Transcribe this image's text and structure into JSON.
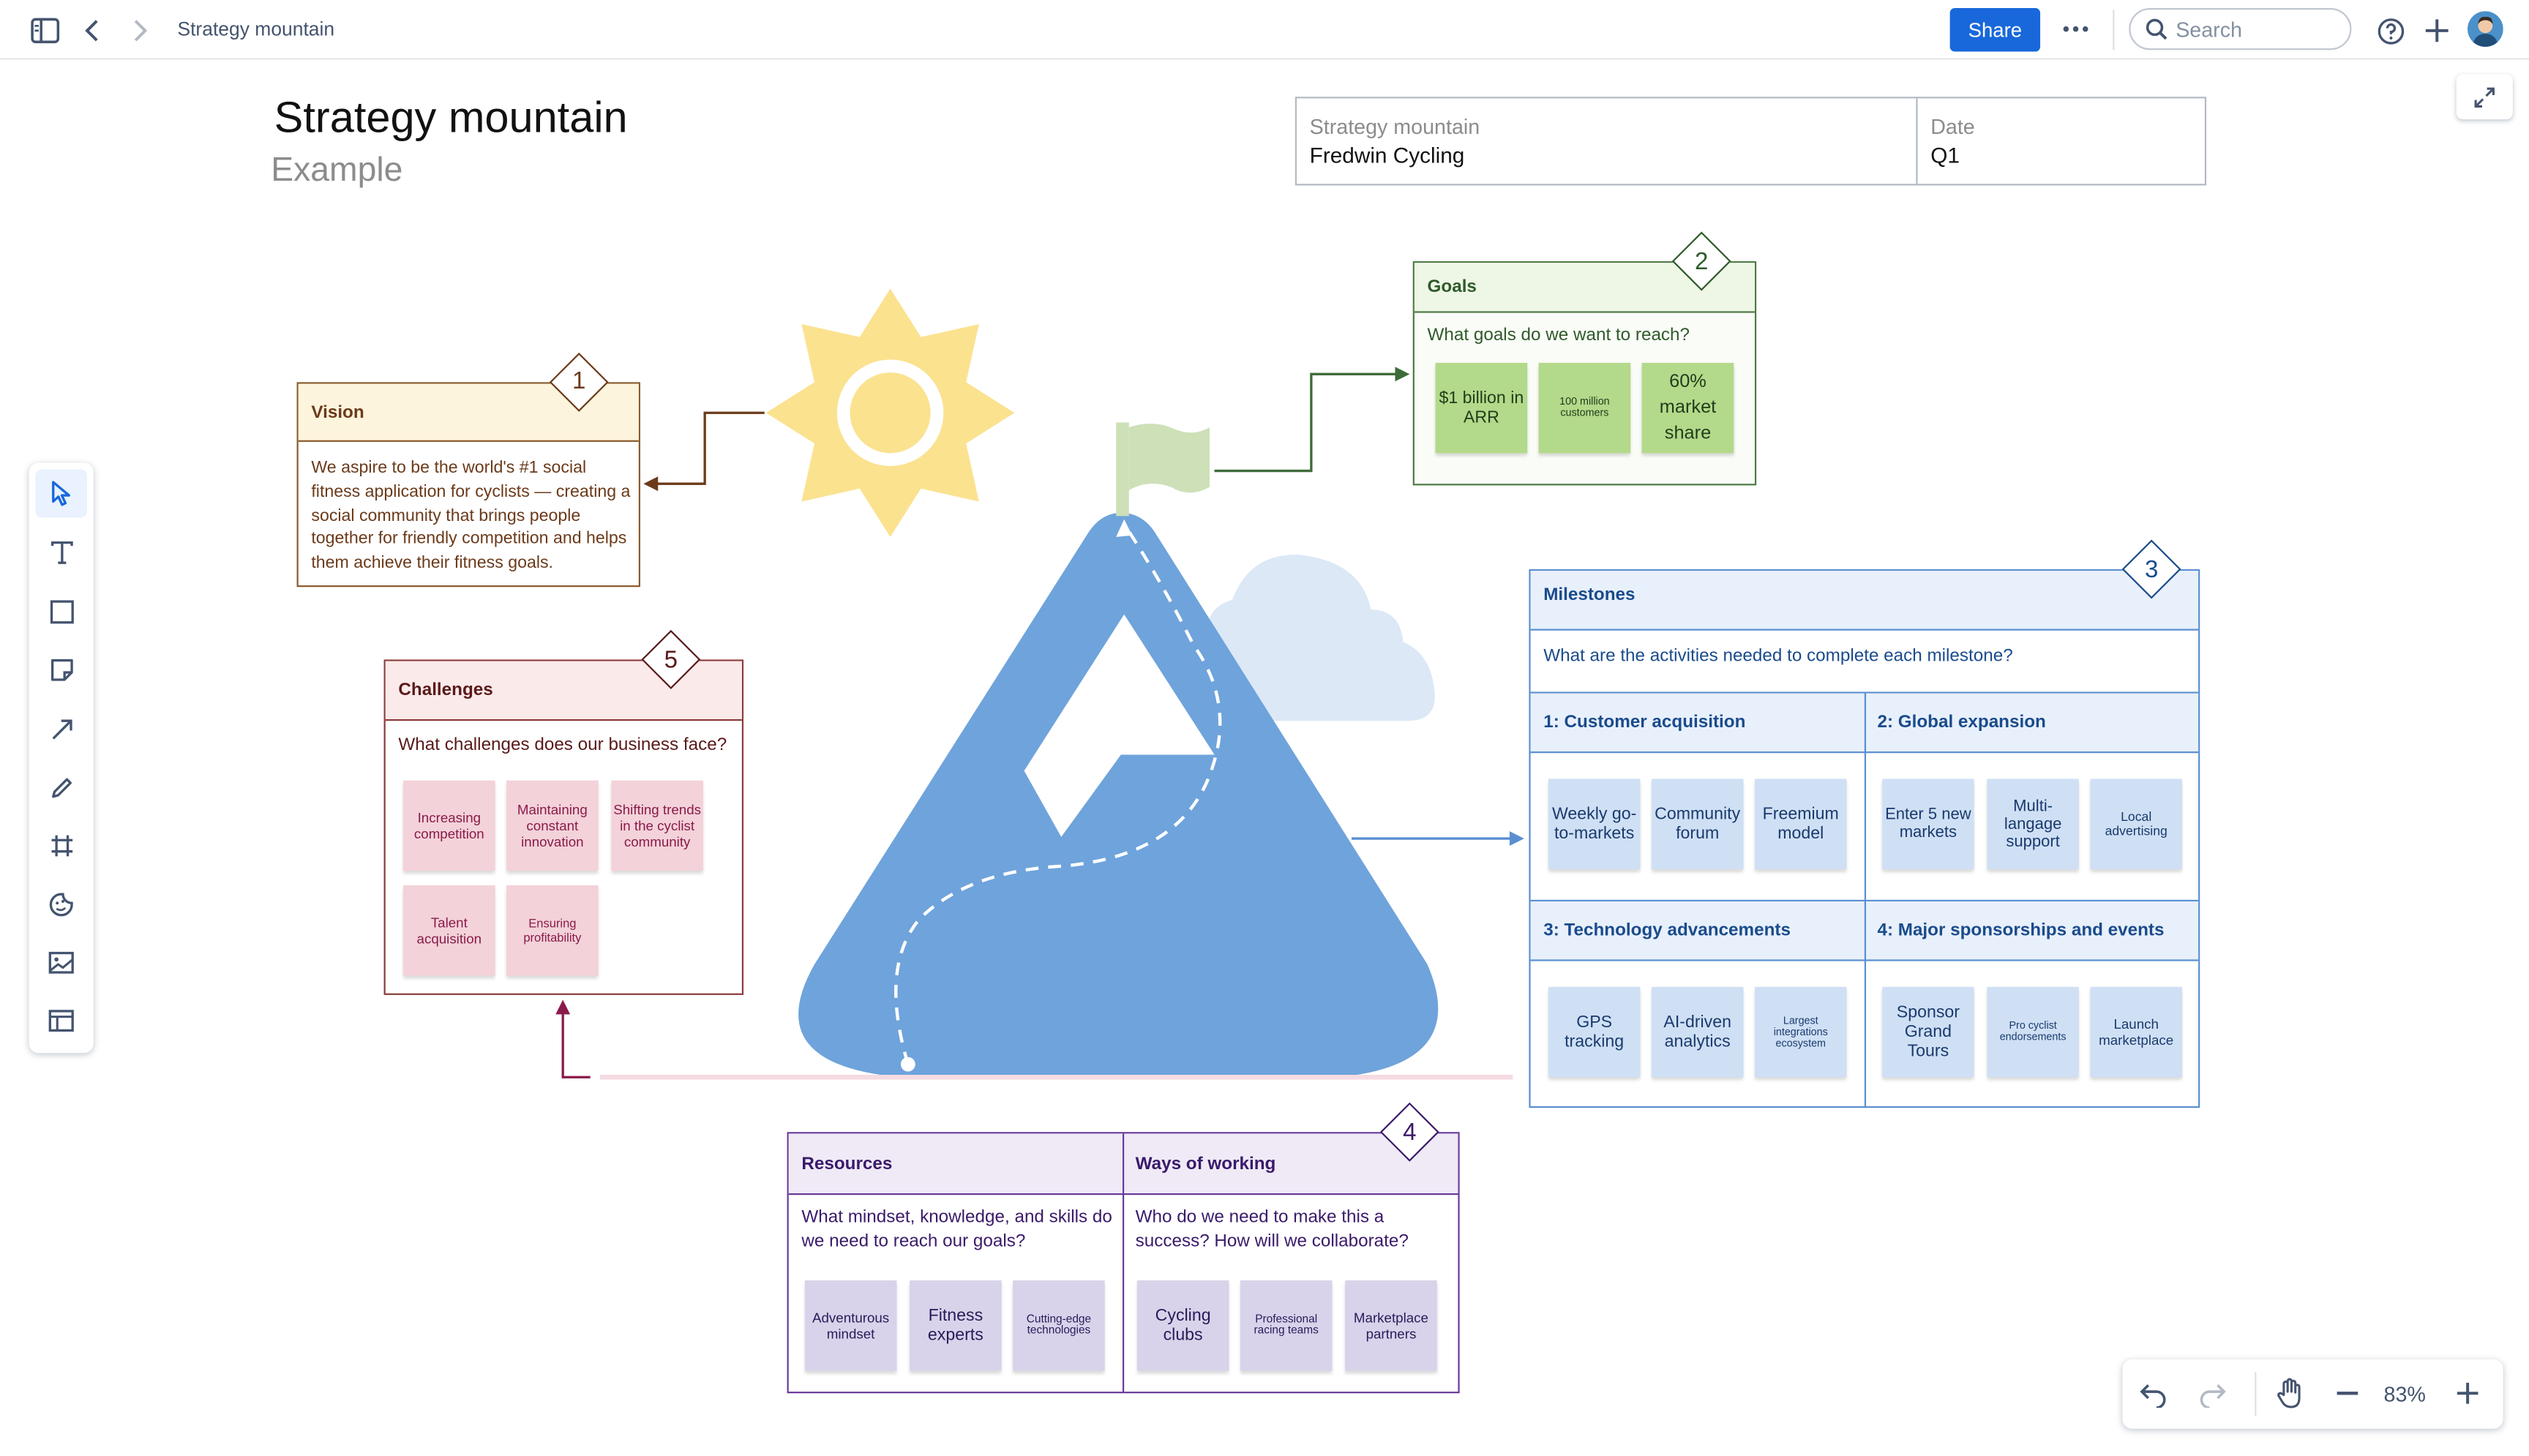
{
  "topbar": {
    "breadcrumb": "Strategy mountain",
    "share_label": "Share",
    "more_label": "•••",
    "search_placeholder": "Search"
  },
  "header": {
    "title": "Strategy mountain",
    "subtitle": "Example",
    "table": {
      "col1_label": "Strategy mountain",
      "col1_value": "Fredwin Cycling",
      "col2_label": "Date",
      "col2_value": "Q1"
    }
  },
  "vision": {
    "number": "1",
    "title": "Vision",
    "body": "We aspire to be the world's #1 social fitness application for cyclists — creating a social community that brings people together for friendly competition and helps them achieve their fitness goals."
  },
  "goals": {
    "number": "2",
    "title": "Goals",
    "question": "What goals do we want to reach?",
    "stickies": [
      "$1 billion in ARR",
      "100 million customers",
      "60% market share"
    ]
  },
  "milestones": {
    "number": "3",
    "title": "Milestones",
    "question": "What are the activities needed to complete each milestone?",
    "sections": [
      {
        "title": "1: Customer acquisition",
        "stickies": [
          "Weekly go-to-markets",
          "Community forum",
          "Freemium model"
        ]
      },
      {
        "title": "2: Global expansion",
        "stickies": [
          "Enter 5 new markets",
          "Multi-langage support",
          "Local advertising"
        ]
      },
      {
        "title": "3: Technology advancements",
        "stickies": [
          "GPS tracking",
          "AI-driven analytics",
          "Largest integrations ecosystem"
        ]
      },
      {
        "title": "4: Major sponsorships and events",
        "stickies": [
          "Sponsor Grand Tours",
          "Pro cyclist endorsements",
          "Launch marketplace"
        ]
      }
    ]
  },
  "resources": {
    "number": "4",
    "title": "Resources",
    "question": "What mindset, knowledge, and skills do we need to reach our goals?",
    "stickies": [
      "Adventurous mindset",
      "Fitness experts",
      "Cutting-edge technologies"
    ]
  },
  "ways": {
    "title": "Ways of working",
    "question": "Who do we need to make this a success? How will we collaborate?",
    "stickies": [
      "Cycling clubs",
      "Professional racing teams",
      "Marketplace partners"
    ]
  },
  "challenges": {
    "number": "5",
    "title": "Challenges",
    "question": "What challenges does our business face?",
    "stickies": [
      "Increasing competition",
      "Maintaining constant innovation",
      "Shifting trends in the cyclist community",
      "Talent acquisition",
      "Ensuring profitability"
    ]
  },
  "zoom": {
    "level": "83%"
  },
  "colors": {
    "vision": "#fdf2d8",
    "goals_sticky": "#b3d98a",
    "milestones_sticky": "#cfe0f5",
    "challenges_sticky": "#f3d2d9",
    "resources_sticky": "#d8d3ea",
    "mountain": "#6fa3db",
    "accent": "#1868db"
  }
}
